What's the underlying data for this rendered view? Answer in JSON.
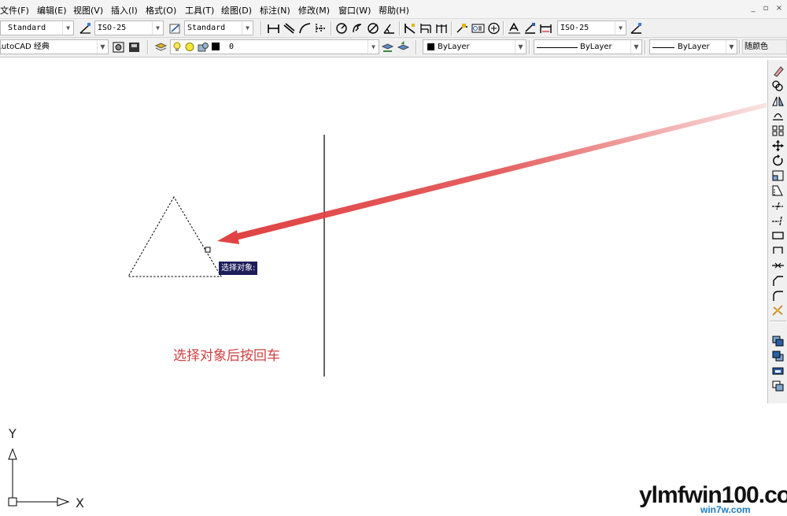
{
  "menu": {
    "items": [
      "文件(F)",
      "编辑(E)",
      "视图(V)",
      "插入(I)",
      "格式(O)",
      "工具(T)",
      "绘图(D)",
      "标注(N)",
      "修改(M)",
      "窗口(W)",
      "帮助(H)"
    ],
    "window_controls": [
      "_",
      "▫",
      "×"
    ]
  },
  "styles_toolbar": {
    "text_style": "Standard",
    "dim_style": "ISO-25",
    "table_style": "Standard",
    "dim_style_right": "ISO-25"
  },
  "layers_toolbar": {
    "workspace": "AutoCAD 经典",
    "layer": "0",
    "color": "ByLayer",
    "linetype": "ByLayer",
    "lineweight": "ByLayer",
    "plot_style": "随颜色"
  },
  "canvas": {
    "tooltip": "选择对象:",
    "hint": "选择对象后按回车",
    "ucs_y": "Y",
    "ucs_x": "X"
  },
  "colors": {
    "arrow": "#e04343",
    "hint_text": "#d04141",
    "tooltip_bg": "#1d1d5a"
  },
  "watermark": {
    "main": "ylmfwin100.com",
    "sub": "win7w.com"
  }
}
